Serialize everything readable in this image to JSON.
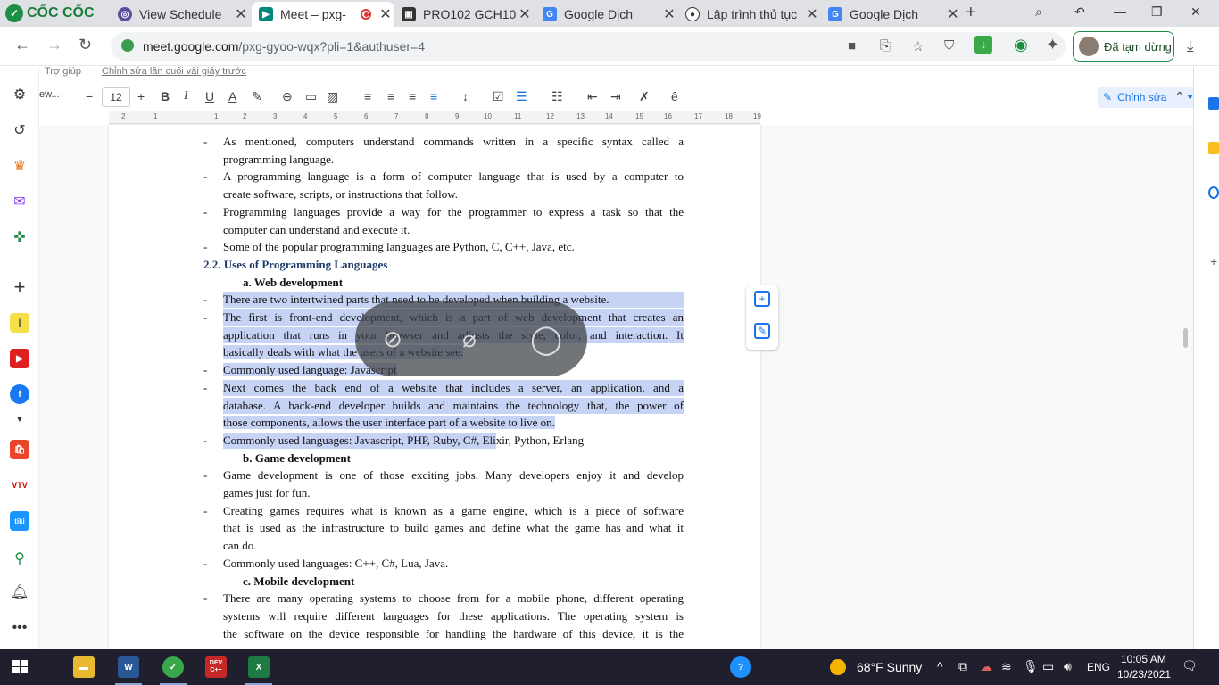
{
  "browser": {
    "brand": "CỐC CỐC",
    "tabs": [
      {
        "title": "View Schedule",
        "icon": "schedule-icon",
        "color": "#5b4fa0"
      },
      {
        "title": "Meet – pxg-",
        "icon": "meet-icon",
        "color": "#00897b",
        "active": true,
        "recording": true
      },
      {
        "title": "PRO102 GCH10(",
        "icon": "document-icon",
        "color": "#333333"
      },
      {
        "title": "Google Dịch",
        "icon": "translate-icon",
        "color": "#4285f4"
      },
      {
        "title": "Lập trình thủ tục",
        "icon": "globe-icon",
        "color": "#333333"
      },
      {
        "title": "Google Dịch",
        "icon": "translate-icon",
        "color": "#4285f4"
      }
    ],
    "url_host": "meet.google.com",
    "url_path": "/pxg-gyoo-wqx?pli=1&authuser=4",
    "profile_status": "Đã tạm dừng"
  },
  "docs": {
    "menu_items": [
      "Trợ giúp",
      "Chỉnh sửa lần cuối vài giây trước"
    ],
    "font_name": "ew...",
    "font_size": "12",
    "edit_mode": "Chỉnh sửa",
    "ruler_numbers": [
      "2",
      "1",
      "1",
      "2",
      "3",
      "4",
      "5",
      "6",
      "7",
      "8",
      "9",
      "10",
      "11",
      "12",
      "13",
      "14",
      "15",
      "16",
      "17",
      "18",
      "19"
    ]
  },
  "document": {
    "lines": [
      {
        "bullet": true,
        "text": "As mentioned, computers understand commands written in a specific syntax called a",
        "just": true
      },
      {
        "text": "programming language."
      },
      {
        "bullet": true,
        "text": "A programming language is a form of computer language that is used by a computer to",
        "just": true
      },
      {
        "text": "create software, scripts, or instructions that follow."
      },
      {
        "bullet": true,
        "text": "Programming languages provide a way for the programmer to express a task so that the",
        "just": true
      },
      {
        "text": "computer can understand and execute it."
      },
      {
        "bullet": true,
        "text": "Some of the popular programming languages are Python, C, C++, Java, etc."
      }
    ],
    "section_heading": "2.2. Uses of Programming Languages",
    "sub_a": "a.   Web development",
    "web_lines": [
      {
        "bullet": true,
        "text": "There are two intertwined parts that need to be developed when building a website.",
        "sel": "full"
      },
      {
        "bullet": true,
        "text": "The first is front-end development, which is a part of web development that creates an",
        "just": true,
        "sel": "full"
      },
      {
        "text": "application that runs in your browser and adjusts the style, color, and interaction. It",
        "just": true,
        "sel": "full"
      },
      {
        "text": "basically deals with what the users of a website see.",
        "sel": "partial"
      },
      {
        "bullet": true,
        "text": "Commonly used language: Javascript",
        "sel": "partial"
      },
      {
        "bullet": true,
        "text": "Next comes the back end of a website that includes a server, an application, and a",
        "just": true,
        "sel": "full"
      },
      {
        "text": "database. A back-end developer builds and maintains the technology that, the power of",
        "just": true,
        "sel": "full"
      },
      {
        "text": "those components, allows the user interface part of a website to live on.",
        "sel": "partial"
      },
      {
        "bullet": true,
        "text": "Commonly used languages: Javascript, PHP, Ruby, C#, Elixir, Python, Erlang",
        "sel": "head"
      }
    ],
    "sub_b": "b.   Game development",
    "game_lines": [
      {
        "bullet": true,
        "text": "Game development is one of those exciting jobs. Many developers enjoy it and develop",
        "just": true
      },
      {
        "text": "games just for fun."
      },
      {
        "bullet": true,
        "text": "Creating games requires what is known as a game engine, which is a piece of software",
        "just": true
      },
      {
        "text": "that is used as the infrastructure to build games and define what the game has and what it",
        "just": true
      },
      {
        "text": "can do."
      },
      {
        "bullet": true,
        "text": "Commonly used languages: C++, C#, Lua, Java."
      }
    ],
    "sub_c": "c.   Mobile development",
    "mobile_lines": [
      {
        "bullet": true,
        "text": "There are many operating systems to choose from for a mobile phone, different operating",
        "just": true
      },
      {
        "text": "systems will require different languages for these applications. The operating system is",
        "just": true
      },
      {
        "text": "the software on the device responsible for handling the hardware of this device, it is the",
        "just": true
      }
    ]
  },
  "taskbar": {
    "weather": "68°F  Sunny",
    "language": "ENG",
    "time": "10:05 AM",
    "date": "10/23/2021",
    "app_labels": [
      "W",
      "DEV C++",
      "X"
    ]
  },
  "colors": {
    "selection": "#c6d3f5",
    "heading": "#1f3a6b",
    "accent": "#1a73e8"
  }
}
